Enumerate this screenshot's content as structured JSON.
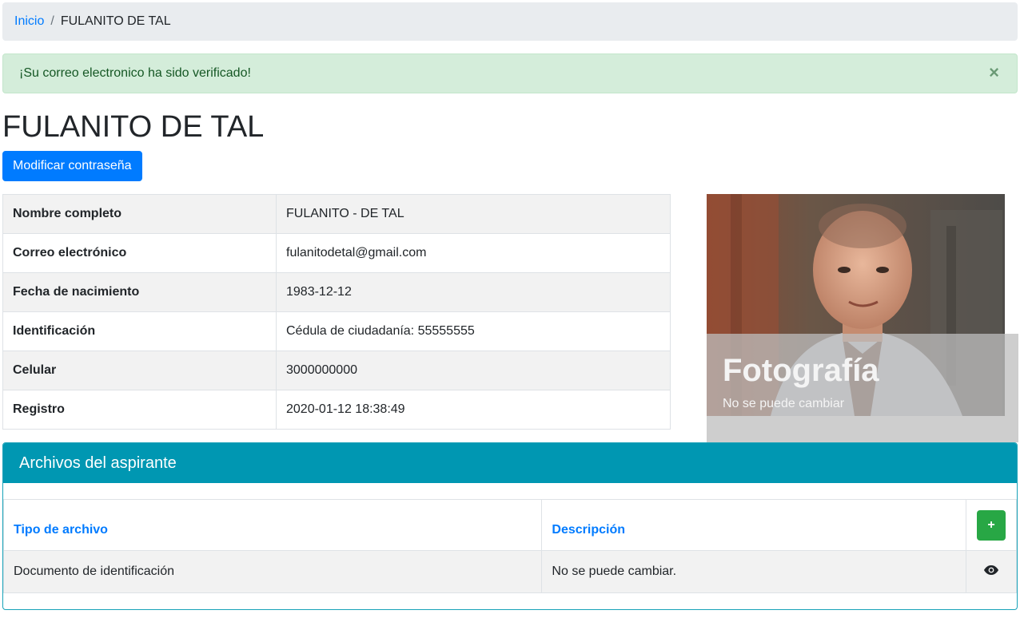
{
  "breadcrumb": {
    "home": "Inicio",
    "separator": "/",
    "current": "FULANITO DE TAL"
  },
  "alert": {
    "message": "¡Su correo electronico ha sido verificado!",
    "close": "×"
  },
  "profile": {
    "title": "FULANITO DE TAL",
    "change_password_label": "Modificar contraseña",
    "fields": [
      {
        "label": "Nombre completo",
        "value": "FULANITO - DE TAL"
      },
      {
        "label": "Correo electrónico",
        "value": "fulanitodetal@gmail.com"
      },
      {
        "label": "Fecha de nacimiento",
        "value": "1983-12-12"
      },
      {
        "label": "Identificación",
        "value": "Cédula de ciudadanía: 55555555"
      },
      {
        "label": "Celular",
        "value": "3000000000"
      },
      {
        "label": "Registro",
        "value": "2020-01-12 18:38:49"
      }
    ]
  },
  "photo": {
    "title": "Fotografía",
    "subtitle": "No se puede cambiar"
  },
  "files": {
    "header": "Archivos del aspirante",
    "columns": {
      "type": "Tipo de archivo",
      "description": "Descripción",
      "add": "+"
    },
    "rows": [
      {
        "type": "Documento de identificación",
        "description": "No se puede cambiar.",
        "action_icon": "eye-icon"
      }
    ]
  },
  "colors": {
    "primary": "#007bff",
    "success": "#28a745",
    "info": "#0097b2",
    "alert_bg": "#d4edda"
  }
}
